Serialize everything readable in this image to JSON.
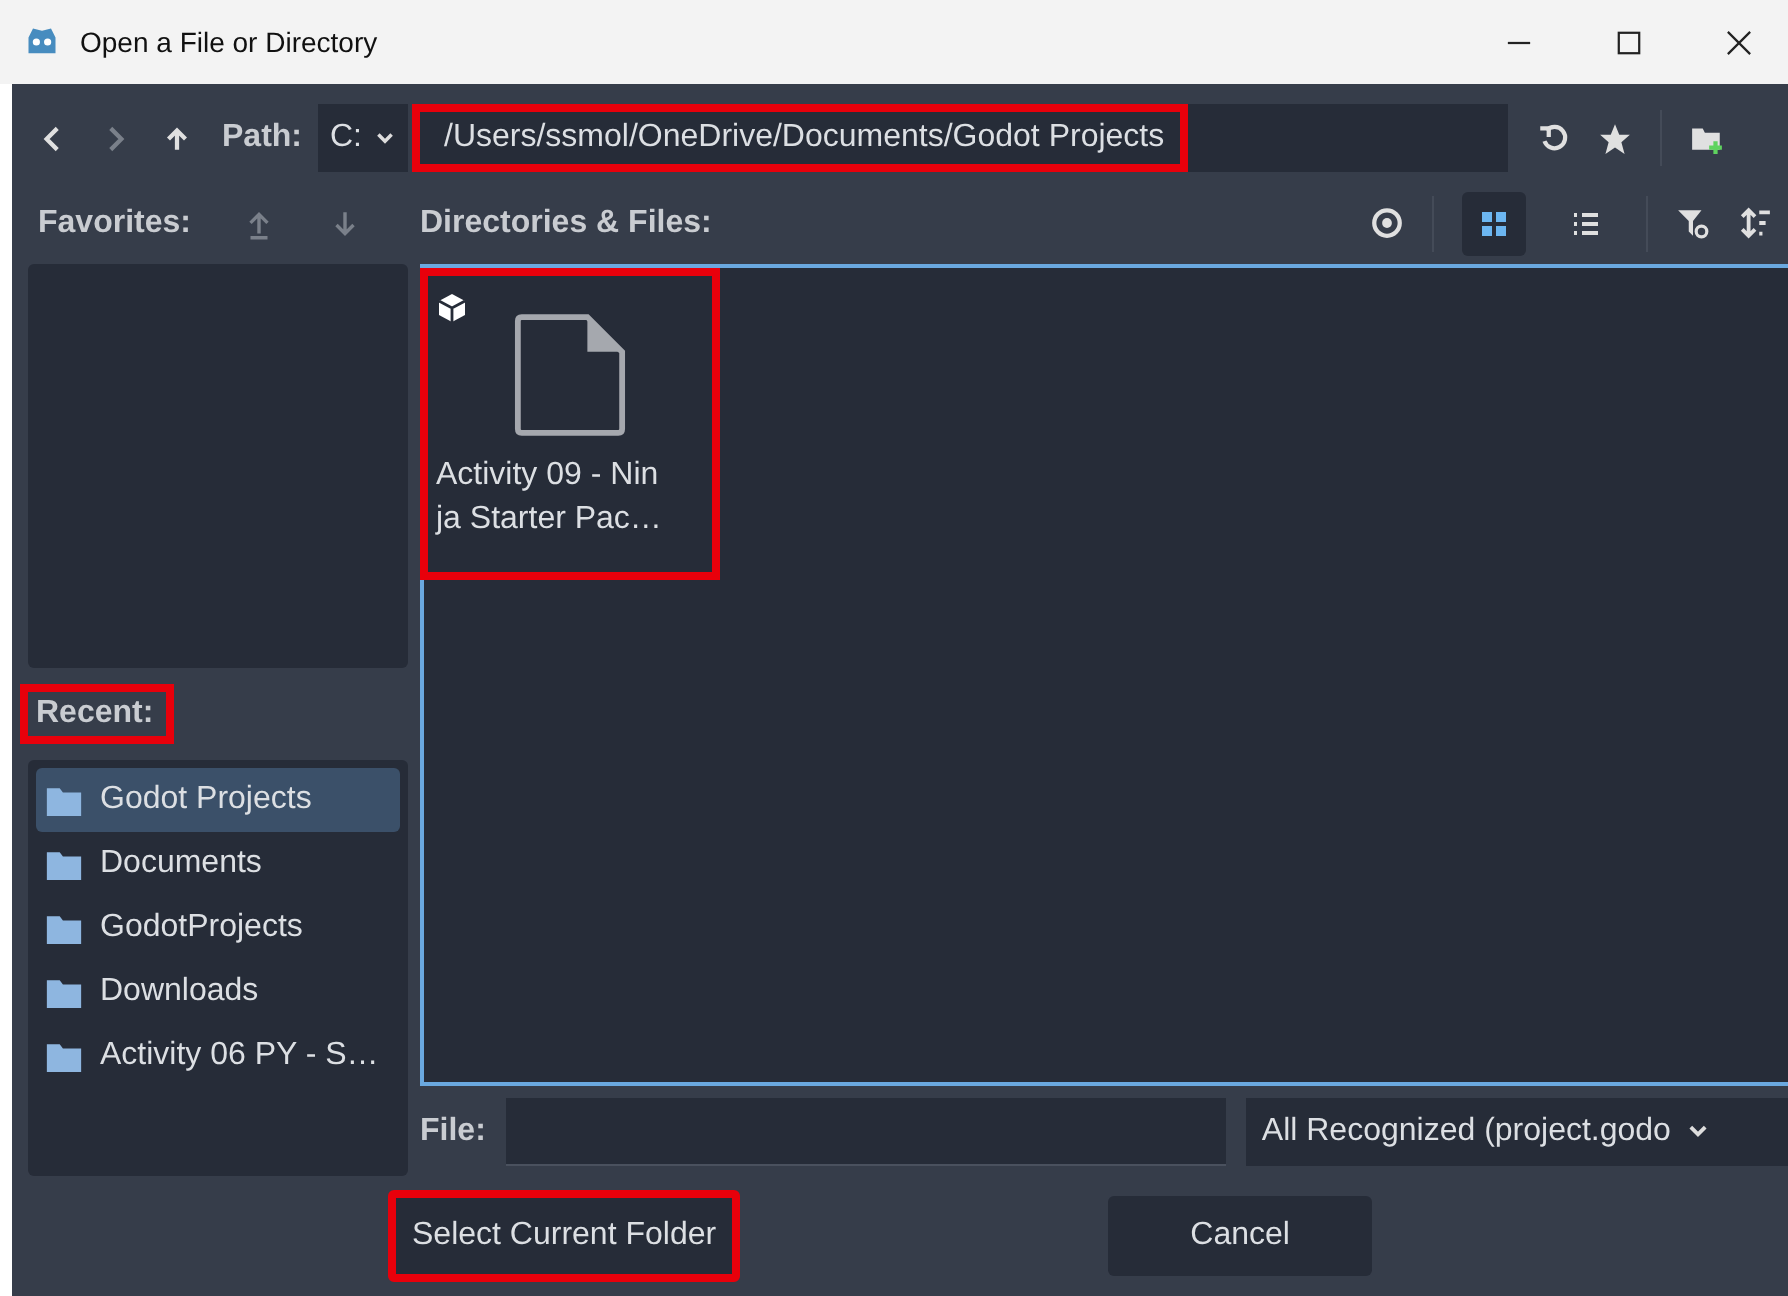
{
  "window": {
    "title": "Open a File or Directory"
  },
  "toolbar": {
    "path_label": "Path:",
    "drive": "C:",
    "path": "/Users/ssmol/OneDrive/Documents/Godot Projects",
    "path_highlighted": true
  },
  "favorites": {
    "label": "Favorites:"
  },
  "files_header": {
    "label": "Directories & Files:",
    "view_modes": [
      {
        "kind": "grid",
        "selected": true
      },
      {
        "kind": "list",
        "selected": false
      }
    ]
  },
  "files": [
    {
      "name_lines": [
        "Activity 09 - Nin",
        "ja Starter Pac…"
      ],
      "highlighted": true
    }
  ],
  "recent": {
    "label": "Recent:",
    "highlighted": true,
    "items": [
      {
        "label": "Godot Projects",
        "selected": true
      },
      {
        "label": "Documents",
        "selected": false
      },
      {
        "label": "GodotProjects",
        "selected": false
      },
      {
        "label": "Downloads",
        "selected": false
      },
      {
        "label": "Activity 06 PY - S…",
        "selected": false
      }
    ]
  },
  "file_row": {
    "label": "File:",
    "filter": "All Recognized (project.godo"
  },
  "buttons": [
    {
      "label": "Select Current Folder",
      "highlighted": true
    },
    {
      "label": "Cancel",
      "highlighted": false
    }
  ]
}
